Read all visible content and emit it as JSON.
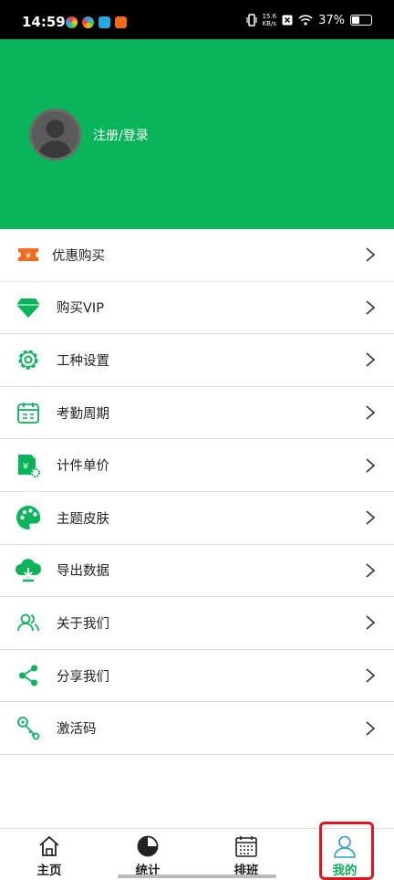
{
  "status_bar": {
    "time": "14:59",
    "net_speed_value": "15.6",
    "net_speed_unit": "KB/s",
    "battery": "37%",
    "battery_level": 0.37
  },
  "header": {
    "login_text": "注册/登录",
    "bg_color": "#09b45a"
  },
  "menu": {
    "items": [
      {
        "label": "优惠购买",
        "icon": "coupon-icon"
      },
      {
        "label": "购买VIP",
        "icon": "diamond-icon"
      },
      {
        "label": "工种设置",
        "icon": "gear-icon"
      },
      {
        "label": "考勤周期",
        "icon": "calendar-icon"
      },
      {
        "label": "计件单价",
        "icon": "price-doc-icon"
      },
      {
        "label": "主题皮肤",
        "icon": "palette-icon"
      },
      {
        "label": "导出数据",
        "icon": "cloud-download-icon"
      },
      {
        "label": "关于我们",
        "icon": "people-icon"
      },
      {
        "label": "分享我们",
        "icon": "share-icon"
      },
      {
        "label": "激活码",
        "icon": "key-icon"
      }
    ]
  },
  "tabbar": {
    "tabs": [
      {
        "label": "主页",
        "icon": "home-icon"
      },
      {
        "label": "统计",
        "icon": "pie-chart-icon"
      },
      {
        "label": "排班",
        "icon": "schedule-icon"
      },
      {
        "label": "我的",
        "icon": "person-icon",
        "active": true
      }
    ],
    "accent_color": "#09b45a",
    "highlight_color": "#e0141e"
  }
}
